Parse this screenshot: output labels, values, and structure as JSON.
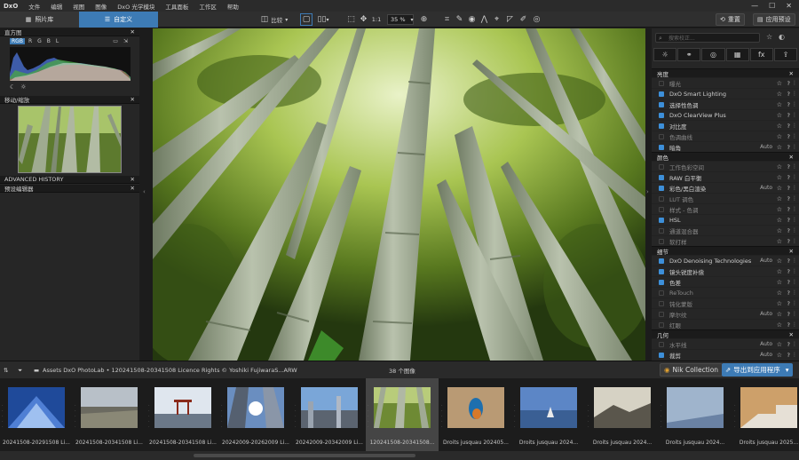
{
  "menubar": {
    "logo": "DxO",
    "items": [
      "文件",
      "编辑",
      "视图",
      "图像",
      "DxO 光学模块",
      "工具面板",
      "工作区",
      "帮助"
    ]
  },
  "toolbar": {
    "tab_library": "照片库",
    "tab_customize": "自定义",
    "compare": "比较",
    "one_to_one": "1:1",
    "zoom": "35 %",
    "reset": "重置",
    "apply_preset": "应用预设"
  },
  "left_panel": {
    "histogram_title": "直方图",
    "channels": [
      "RGB",
      "R",
      "G",
      "B",
      "L"
    ],
    "navigator_title": "移动/缩放",
    "history_title": "ADVANCED HISTORY",
    "preset_editor_title": "预设编辑器"
  },
  "right_panel": {
    "search_placeholder": "搜索校正...",
    "category_icons": [
      "sun-icon",
      "color-circles-icon",
      "aperture-icon",
      "grid-icon",
      "fx-icon",
      "export-icon"
    ],
    "category_fx_label": "fx",
    "sections": [
      {
        "title": "亮度",
        "rows": [
          {
            "label": "曝光",
            "active": false,
            "auto": ""
          },
          {
            "label": "DxO Smart Lighting",
            "active": true,
            "auto": ""
          },
          {
            "label": "选择性色调",
            "active": true,
            "auto": ""
          },
          {
            "label": "DxO ClearView Plus",
            "active": true,
            "auto": ""
          },
          {
            "label": "对比度",
            "active": true,
            "auto": ""
          },
          {
            "label": "色调曲线",
            "active": false,
            "auto": ""
          },
          {
            "label": "暗角",
            "active": true,
            "auto": "Auto"
          }
        ]
      },
      {
        "title": "颜色",
        "rows": [
          {
            "label": "工作色彩空间",
            "active": false,
            "auto": ""
          },
          {
            "label": "RAW 白平衡",
            "active": true,
            "auto": ""
          },
          {
            "label": "彩色/黑白渲染",
            "active": true,
            "auto": "Auto"
          },
          {
            "label": "LUT 调色",
            "active": false,
            "auto": ""
          },
          {
            "label": "样式 - 色调",
            "active": false,
            "auto": ""
          },
          {
            "label": "HSL",
            "active": true,
            "auto": ""
          },
          {
            "label": "通道混合器",
            "active": false,
            "auto": ""
          },
          {
            "label": "软打样",
            "active": false,
            "auto": ""
          }
        ]
      },
      {
        "title": "细节",
        "rows": [
          {
            "label": "DxO Denoising Technologies",
            "active": true,
            "auto": "Auto"
          },
          {
            "label": "镜头锐度补偿",
            "active": true,
            "auto": ""
          },
          {
            "label": "色差",
            "active": true,
            "auto": ""
          },
          {
            "label": "ReTouch",
            "active": false,
            "auto": ""
          },
          {
            "label": "钝化蒙版",
            "active": false,
            "auto": ""
          },
          {
            "label": "摩尔纹",
            "active": false,
            "auto": "Auto"
          },
          {
            "label": "红眼",
            "active": false,
            "auto": ""
          }
        ]
      },
      {
        "title": "几何",
        "rows": [
          {
            "label": "水平线",
            "active": false,
            "auto": "Auto"
          },
          {
            "label": "裁剪",
            "active": true,
            "auto": "Auto"
          }
        ]
      }
    ]
  },
  "filmstrip_bar": {
    "path": "Assets DxO PhotoLab • 120241508-20341508 Licence Rights © Yoshiki FujiwaraS...ARW",
    "count": "38 个图像",
    "nik": "Nik Collection",
    "export": "导出到应用程序"
  },
  "thumbnails": [
    {
      "caption": "20241508-20291508 Li...",
      "kind": "blue"
    },
    {
      "caption": "20241508-20341508 Li...",
      "kind": "coast"
    },
    {
      "caption": "20241508-20341508 Li...",
      "kind": "torii"
    },
    {
      "caption": "20242009-20262009 Li...",
      "kind": "buildings"
    },
    {
      "caption": "20242009-20342009 Li...",
      "kind": "city"
    },
    {
      "caption": "120241508-20341508...",
      "kind": "bamboo"
    },
    {
      "caption": "Droits jusquau 202405...",
      "kind": "bird"
    },
    {
      "caption": "Droits jusquau 2024...",
      "kind": "lake"
    },
    {
      "caption": "Droits jusquau 2024...",
      "kind": "mountain"
    },
    {
      "caption": "Droits jusquau 2024...",
      "kind": "fog"
    },
    {
      "caption": "Droits jusquau 2025...",
      "kind": "stairs"
    }
  ]
}
